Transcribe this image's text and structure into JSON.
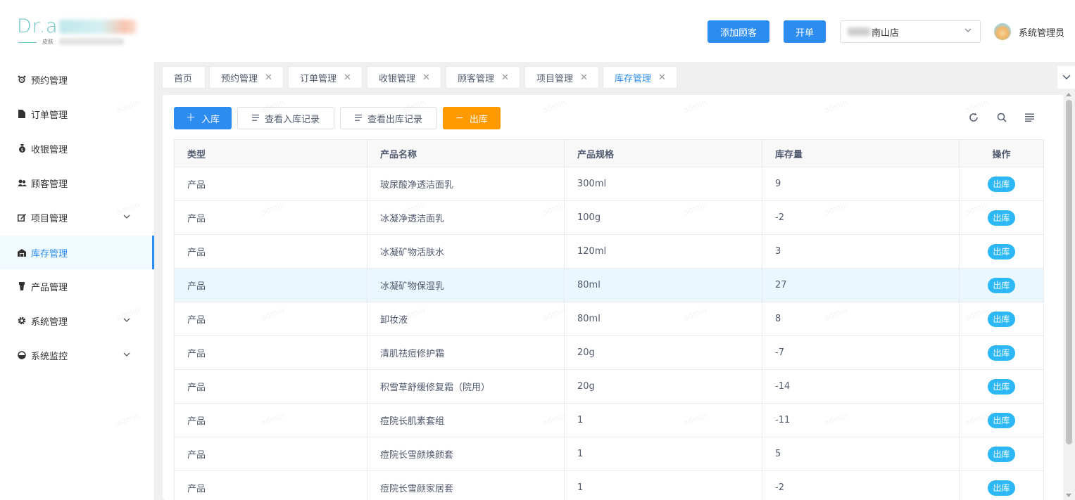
{
  "header": {
    "logo_text": "Dr.a",
    "logo_sub": "皮肤",
    "add_customer_label": "添加顾客",
    "open_order_label": "开单",
    "store_selected": "南山店",
    "user_name": "系统管理员"
  },
  "sidebar": {
    "items": [
      {
        "label": "预约管理",
        "icon": "alarm-clock-icon"
      },
      {
        "label": "订单管理",
        "icon": "document-icon"
      },
      {
        "label": "收银管理",
        "icon": "money-bag-icon"
      },
      {
        "label": "顾客管理",
        "icon": "users-icon"
      },
      {
        "label": "项目管理",
        "icon": "edit-icon",
        "expandable": true
      },
      {
        "label": "库存管理",
        "icon": "warehouse-icon",
        "active": true
      },
      {
        "label": "产品管理",
        "icon": "bottle-icon"
      },
      {
        "label": "系统管理",
        "icon": "gear-icon",
        "expandable": true
      },
      {
        "label": "系统监控",
        "icon": "monitor-icon",
        "expandable": true
      }
    ]
  },
  "tabs": [
    {
      "label": "首页",
      "closable": false
    },
    {
      "label": "预约管理",
      "closable": true
    },
    {
      "label": "订单管理",
      "closable": true
    },
    {
      "label": "收银管理",
      "closable": true
    },
    {
      "label": "顾客管理",
      "closable": true
    },
    {
      "label": "项目管理",
      "closable": true
    },
    {
      "label": "库存管理",
      "closable": true,
      "active": true
    }
  ],
  "toolbar": {
    "in_label": "入库",
    "in_records_label": "查看入库记录",
    "out_records_label": "查看出库记录",
    "out_label": "出库"
  },
  "table": {
    "columns": [
      "类型",
      "产品名称",
      "产品规格",
      "库存量",
      "操作"
    ],
    "action_label": "出库",
    "rows": [
      {
        "type": "产品",
        "name": "玻尿酸净透洁面乳",
        "spec": "300ml",
        "stock": "9"
      },
      {
        "type": "产品",
        "name": "冰凝净透洁面乳",
        "spec": "100g",
        "stock": "-2"
      },
      {
        "type": "产品",
        "name": "冰凝矿物活肤水",
        "spec": "120ml",
        "stock": "3"
      },
      {
        "type": "产品",
        "name": "冰凝矿物保湿乳",
        "spec": "80ml",
        "stock": "27"
      },
      {
        "type": "产品",
        "name": "卸妆液",
        "spec": "80ml",
        "stock": "8"
      },
      {
        "type": "产品",
        "name": "清肌祛痘修护霜",
        "spec": "20g",
        "stock": "-7"
      },
      {
        "type": "产品",
        "name": "积雪草舒缓修复霜（院用）",
        "spec": "20g",
        "stock": "-14"
      },
      {
        "type": "产品",
        "name": "痘院长肌素套组",
        "spec": "1",
        "stock": "-11"
      },
      {
        "type": "产品",
        "name": "痘院长雪颜焕颜套",
        "spec": "1",
        "stock": "5"
      },
      {
        "type": "产品",
        "name": "痘院长雪颜家居套",
        "spec": "1",
        "stock": "-2"
      }
    ]
  },
  "watermark": "admin",
  "colors": {
    "primary": "#2d8cf0",
    "warning": "#ff9900",
    "tag": "#2db7f5"
  }
}
